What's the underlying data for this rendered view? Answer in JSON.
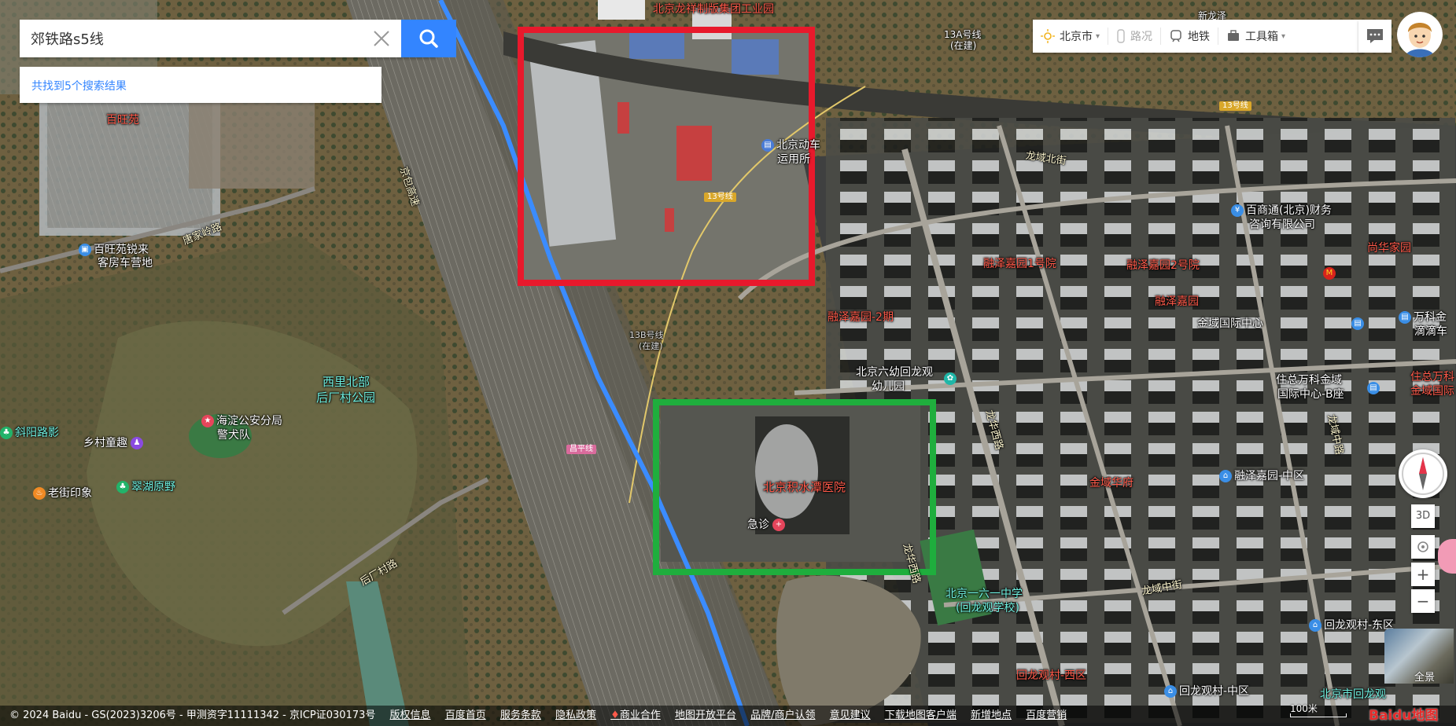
{
  "search": {
    "value": "郊铁路s5线",
    "placeholder": "",
    "result_text": "共找到5个搜索结果"
  },
  "toolbar": {
    "city": "北京市",
    "traffic": "路况",
    "subway": "地铁",
    "toolbox": "工具箱"
  },
  "controls": {
    "three_d": "3D",
    "zoom_in": "+",
    "zoom_out": "−",
    "panorama": "全景"
  },
  "labels": {
    "top_center": "北京龙祥制版集团工业园",
    "top_center2": "集团工业园",
    "line13a": "13A号线",
    "line13a_sub": "(在建)",
    "xinlongze": "新龙泽",
    "baiwangyuan": "百旺苑",
    "jingbao": "京包高速",
    "tangjialing": "唐家岭路",
    "baiwang_camp1": "百旺苑锐来",
    "baiwang_camp2": "客房车营地",
    "emu1": "北京动车",
    "emu2": "运用所",
    "line13_a": "13号线",
    "line13_b": "13号线",
    "line13_c": "13号线",
    "longyu_n": "龙域北街",
    "baishang1": "百商通(北京)财务",
    "baishang2": "咨询有限公司",
    "shanghua": "尚华家园",
    "rongze1": "融泽嘉园1号院",
    "rongze2": "融泽嘉园2号院",
    "rongze": "融泽嘉园",
    "rongze_p2": "融泽嘉园-2期",
    "jinyu_center": "金域国际中心",
    "wanke1": "万科金",
    "wanke2": "滴滴车",
    "line13b1": "13B号线",
    "line13b2": "(在建)",
    "kindergarten1": "北京六幼回龙观",
    "kindergarten2": "幼儿园",
    "zhuzong1": "住总万科金域",
    "zhuzong2": "国际中心-B座",
    "zhuzong_r1": "住总万科",
    "zhuzong_r2": "金域国际",
    "xierqi1": "西里北部",
    "xierqi2": "后厂村公园",
    "police1": "海淀公安分局",
    "police2": "警犬队",
    "xiecun": "斜阳路影",
    "xiangcun": "乡村童趣",
    "changping_line": "昌平线",
    "hospital": "北京积水潭医院",
    "emergency": "急诊",
    "longhuaxi": "龙华西路",
    "longyu": "龙域中路",
    "rongze_mid": "融泽嘉园-中区",
    "jinyuhuafu": "金域华府",
    "laojie": "老街印象",
    "cuihu": "翠湖原野",
    "houchang": "后厂村路",
    "school1": "北京一六一中学",
    "school2": "(回龙观学校)",
    "longyu_middle": "龙域中街",
    "huilong_east": "回龙观村-东区",
    "huilong_west": "回龙观村-西区",
    "huilong_mid": "回龙观村-中区",
    "huilong_school": "北京市回龙观",
    "longhuaxi2": "龙华西路"
  },
  "footer": {
    "copyright": "© 2024 Baidu - GS(2023)3206号 - 甲测资字11111342 - 京ICP证030173号",
    "links": [
      "版权信息",
      "百度首页",
      "服务条款",
      "隐私政策",
      "商业合作",
      "地图开放平台",
      "品牌/商户认领",
      "意见建议",
      "下载地图客户端",
      "新增地点",
      "百度营销"
    ],
    "scale": "100米",
    "logo": "Baidu地图"
  },
  "colors": {
    "highlight_red": "#e8192c",
    "highlight_green": "#1fae3d",
    "route_blue": "#3b8cff",
    "search_blue": "#3385ff"
  }
}
